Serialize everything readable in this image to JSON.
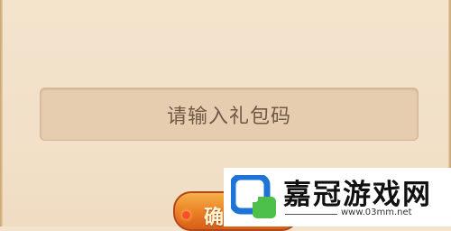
{
  "dialog": {
    "gift_code_input": {
      "placeholder": "请输入礼包码",
      "value": ""
    },
    "confirm_button": {
      "label": "确"
    }
  },
  "watermark": {
    "title": "嘉冠游戏网",
    "domain": "www.03mm.net",
    "colors": {
      "logo_blue": "#1d74d6",
      "logo_green": "#4cc04a"
    }
  },
  "colors": {
    "panel_background": "#f3e3cc",
    "input_background": "#e6cdb0",
    "input_text": "#6e5a47",
    "button_orange": "#ea7d25"
  }
}
